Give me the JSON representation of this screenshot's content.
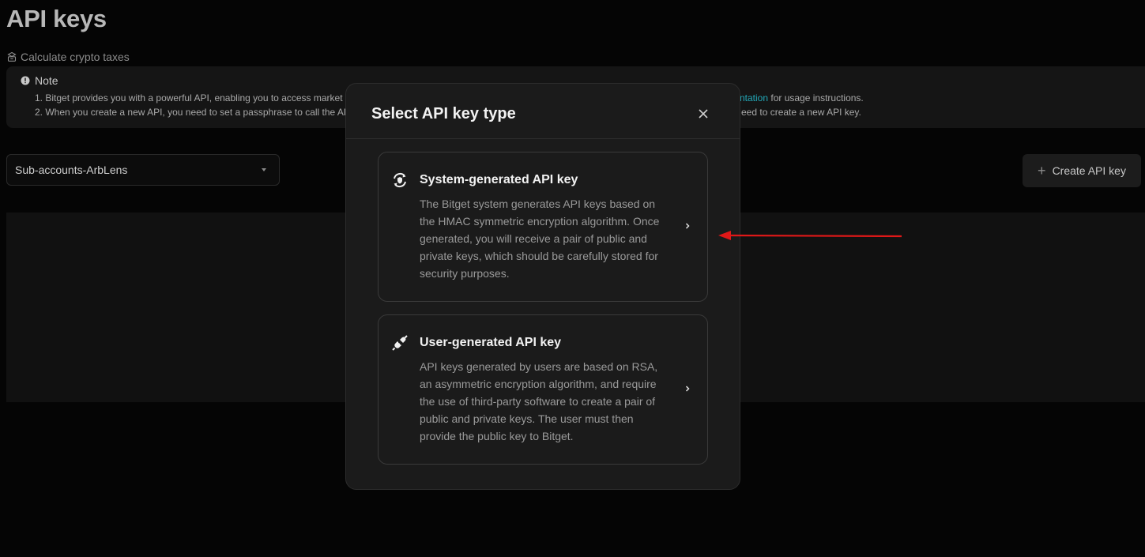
{
  "page": {
    "title": "API keys",
    "tax_link": "Calculate crypto taxes",
    "note": {
      "heading": "Note",
      "line1_left": "1.  Bitget provides you with a powerful API, enabling you to access market",
      "line1_right_link": "ntation",
      "line1_right_text": " for usage instructions.",
      "line2_left": "2.  When you create a new API, you need to set a passphrase to call the AP",
      "line2_right": "eed to create a new API key."
    },
    "account_select": {
      "value": "Sub-accounts-ArbLens"
    },
    "create_button": {
      "plus": "+",
      "label": "Create API key"
    }
  },
  "modal": {
    "title": "Select API key type",
    "options": [
      {
        "title": "System-generated API key",
        "icon": "refresh-shield-icon",
        "description": "The Bitget system generates API keys based on the HMAC symmetric encryption algorithm. Once generated, you will receive a pair of public and private keys, which should be carefully stored for security purposes."
      },
      {
        "title": "User-generated API key",
        "icon": "plug-icon",
        "description": "API keys generated by users are based on RSA, an asymmetric encryption algorithm, and require the use of third-party software to create a pair of public and private keys. The user must then provide the public key to Bitget."
      }
    ]
  },
  "colors": {
    "background": "#050505",
    "modal_bg": "#1b1b1b",
    "link": "#22a8b8",
    "annotation_arrow": "#e01818"
  }
}
